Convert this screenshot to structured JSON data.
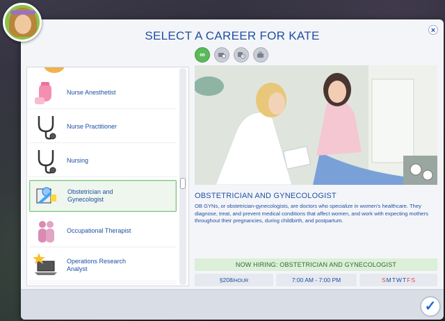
{
  "dialog": {
    "title": "Select a Career for Kate",
    "close_icon": "×",
    "confirm_icon": "✓"
  },
  "filters": [
    {
      "name": "all-careers",
      "icon": "∞",
      "active": true
    },
    {
      "name": "full-time",
      "icon": "camera-clock",
      "active": false
    },
    {
      "name": "part-time",
      "icon": "clock",
      "active": false
    },
    {
      "name": "freelance",
      "icon": "briefcase",
      "active": false
    }
  ],
  "career_list": {
    "items": [
      {
        "label": "Nurse Anesthetist",
        "icon": "syringe-icon"
      },
      {
        "label": "Nurse Practitioner",
        "icon": "stethoscope-icon"
      },
      {
        "label": "Nursing",
        "icon": "stethoscope-icon"
      },
      {
        "label": "Obstetrician and Gynecologist",
        "icon": "baby-puzzle-icon",
        "selected": true
      },
      {
        "label": "Occupational Therapist",
        "icon": "people-icon"
      },
      {
        "label": "Operations Research Analyst",
        "icon": "laptop-star-icon"
      }
    ]
  },
  "detail": {
    "title": "Obstetrician and Gynecologist",
    "description": "OB GYNs, or obstetrician-gynecologists, are doctors who specialize in women's healthcare. They diagnose, treat, and prevent medical conditions that affect women, and work with expecting mothers throughout their pregnancies, during childbirth, and postpartum.",
    "hiring": "Now Hiring: Obstetrician and Gynecologist",
    "pay_symbol": "§",
    "pay": "208",
    "pay_unit": "/hour",
    "hours": "7:00 AM - 7:00 PM",
    "days": [
      {
        "d": "S",
        "off": true
      },
      {
        "d": "M",
        "off": false
      },
      {
        "d": "T",
        "off": false
      },
      {
        "d": "W",
        "off": false
      },
      {
        "d": "T",
        "off": false
      },
      {
        "d": "F",
        "off": true
      },
      {
        "d": "S",
        "off": true
      }
    ]
  },
  "colors": {
    "accent": "#1e4fa3",
    "selected": "#7bc67b",
    "hiring_bg": "#dcefd8",
    "day_off": "#e04848"
  }
}
